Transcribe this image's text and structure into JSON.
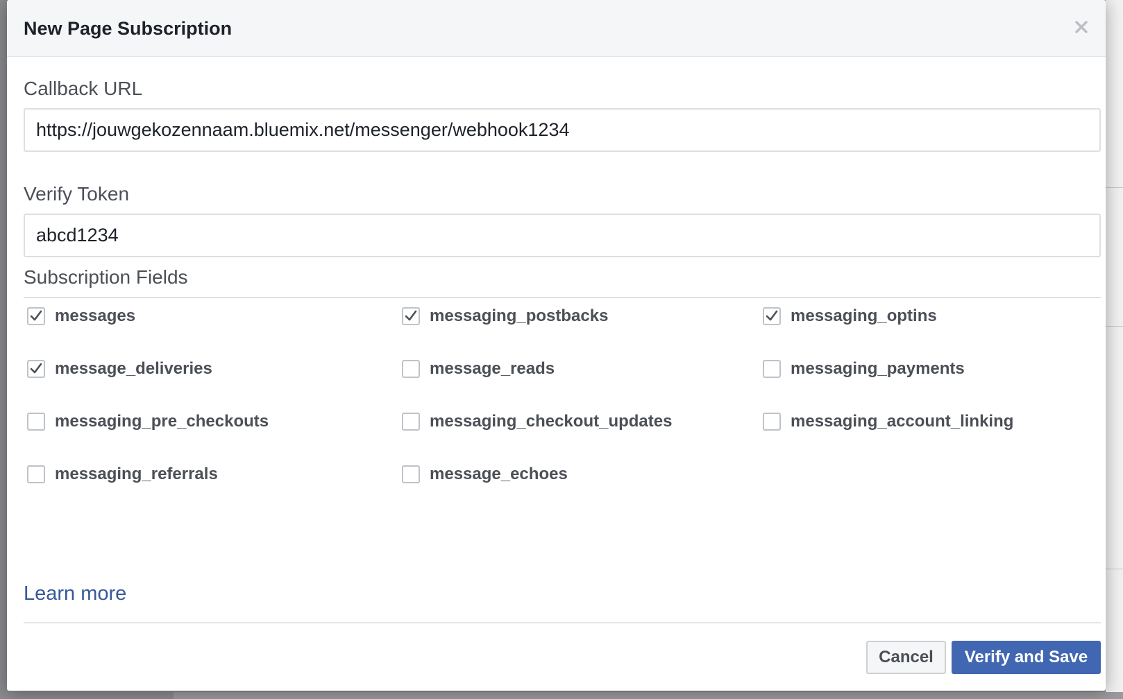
{
  "dialog": {
    "title": "New Page Subscription",
    "close_icon": "close-icon"
  },
  "callback": {
    "label": "Callback URL",
    "value": "https://jouwgekozennaam.bluemix.net/messenger/webhook1234"
  },
  "verify_token": {
    "label": "Verify Token",
    "value": "abcd1234"
  },
  "subscription": {
    "label": "Subscription Fields",
    "fields": [
      {
        "label": "messages",
        "checked": true
      },
      {
        "label": "messaging_postbacks",
        "checked": true
      },
      {
        "label": "messaging_optins",
        "checked": true
      },
      {
        "label": "message_deliveries",
        "checked": true
      },
      {
        "label": "message_reads",
        "checked": false
      },
      {
        "label": "messaging_payments",
        "checked": false
      },
      {
        "label": "messaging_pre_checkouts",
        "checked": false
      },
      {
        "label": "messaging_checkout_updates",
        "checked": false
      },
      {
        "label": "messaging_account_linking",
        "checked": false
      },
      {
        "label": "messaging_referrals",
        "checked": false
      },
      {
        "label": "message_echoes",
        "checked": false
      }
    ]
  },
  "footer": {
    "learn_more": "Learn more",
    "cancel_label": "Cancel",
    "save_label": "Verify and Save"
  },
  "colors": {
    "primary": "#4267b2",
    "link": "#365899",
    "check": "#4b4f56"
  }
}
